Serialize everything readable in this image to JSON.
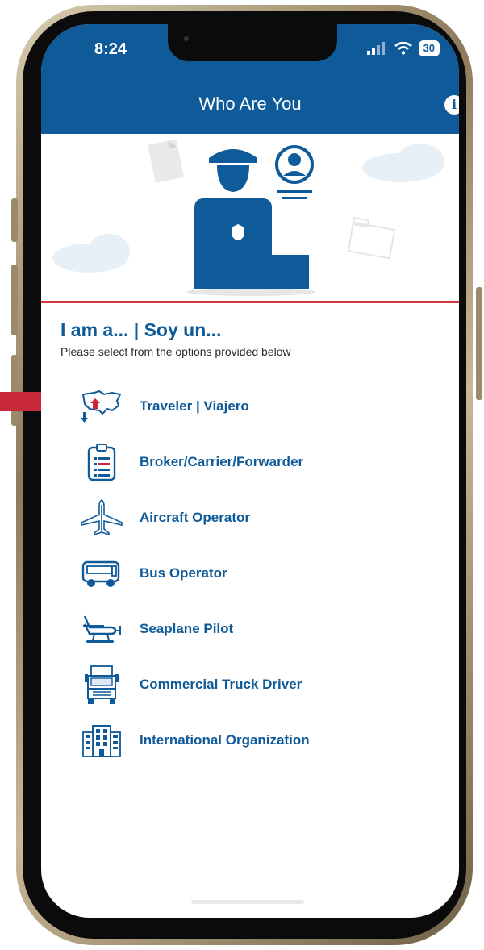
{
  "status_bar": {
    "time": "8:24",
    "battery": "30"
  },
  "header": {
    "title": "Who Are You",
    "info_label": "i"
  },
  "content": {
    "title": "I am a... | Soy un...",
    "subtitle": "Please select from the options provided below"
  },
  "options": [
    {
      "label": "Traveler | Viajero",
      "icon": "us-map-icon"
    },
    {
      "label": "Broker/Carrier/Forwarder",
      "icon": "clipboard-list-icon"
    },
    {
      "label": "Aircraft Operator",
      "icon": "airplane-icon"
    },
    {
      "label": "Bus Operator",
      "icon": "bus-icon"
    },
    {
      "label": "Seaplane Pilot",
      "icon": "seaplane-icon"
    },
    {
      "label": "Commercial Truck Driver",
      "icon": "truck-icon"
    },
    {
      "label": "International Organization",
      "icon": "building-icon"
    }
  ],
  "colors": {
    "primary": "#0f5a99",
    "accent_red": "#d0393d",
    "marker": "#c8293a"
  }
}
